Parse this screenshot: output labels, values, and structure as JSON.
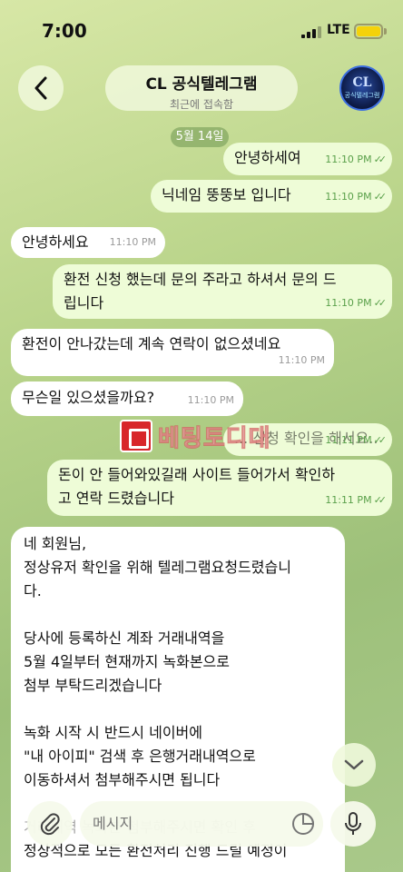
{
  "status_bar": {
    "time": "7:00",
    "network": "LTE"
  },
  "header": {
    "title": "CL 공식텔레그램",
    "status": "최근에 접속함",
    "avatar_main": "CL",
    "avatar_sub": "공식텔레그램"
  },
  "date_chip": "5월 14일",
  "messages": [
    {
      "dir": "out",
      "text": "안녕하세여",
      "time": "11:10 PM"
    },
    {
      "dir": "out",
      "text": "닉네임 뚱뚱보 입니다",
      "time": "11:10 PM"
    },
    {
      "dir": "in",
      "text": "안녕하세요",
      "time": "11:10 PM"
    },
    {
      "dir": "out",
      "line1": "환전 신청 했는데 문의 주라고 하셔서 문의 드",
      "line2": "립니다",
      "time": "11:10 PM"
    },
    {
      "dir": "in",
      "text": "환전이 안나갔는데 계속 연락이 없으셨네요",
      "time": "11:10 PM"
    },
    {
      "dir": "in",
      "text": "무슨일 있으셨을까요?",
      "time": "11:10 PM"
    },
    {
      "dir": "out",
      "text": "... 신청 확인을 해서요..",
      "time": "11:11 PM"
    },
    {
      "dir": "out",
      "line1": "돈이 안 들어와있길래 사이트 들어가서 확인하",
      "line2": "고 연락 드렸습니다",
      "time": "11:11 PM"
    },
    {
      "dir": "in",
      "lines": [
        "네 회원님,",
        "정상유저 확인을 위해 텔레그램요청드렸습니",
        "다.",
        "",
        "당사에 등록하신 계좌 거래내역을",
        "5월 4일부터 현재까지 녹화본으로",
        "첨부 부탁드리겠습니다",
        "",
        "녹화 시작 시 반드시 네이버에",
        "\"내 아이피\" 검색 후 은행거래내역으로",
        "이동하셔서 첨부해주시면 됩니다",
        "",
        "거래내역 녹화본 첨부해주시면 확인 후",
        "정상적으로 모든 환전처리 진행 드릴 예정이"
      ]
    }
  ],
  "watermark": "베팅토디대",
  "input": {
    "placeholder": "메시지"
  },
  "colors": {
    "outgoing_bubble": "#eefcd7",
    "incoming_bubble": "#ffffff",
    "read_check": "#5aa04a",
    "battery": "#f5d20a"
  }
}
